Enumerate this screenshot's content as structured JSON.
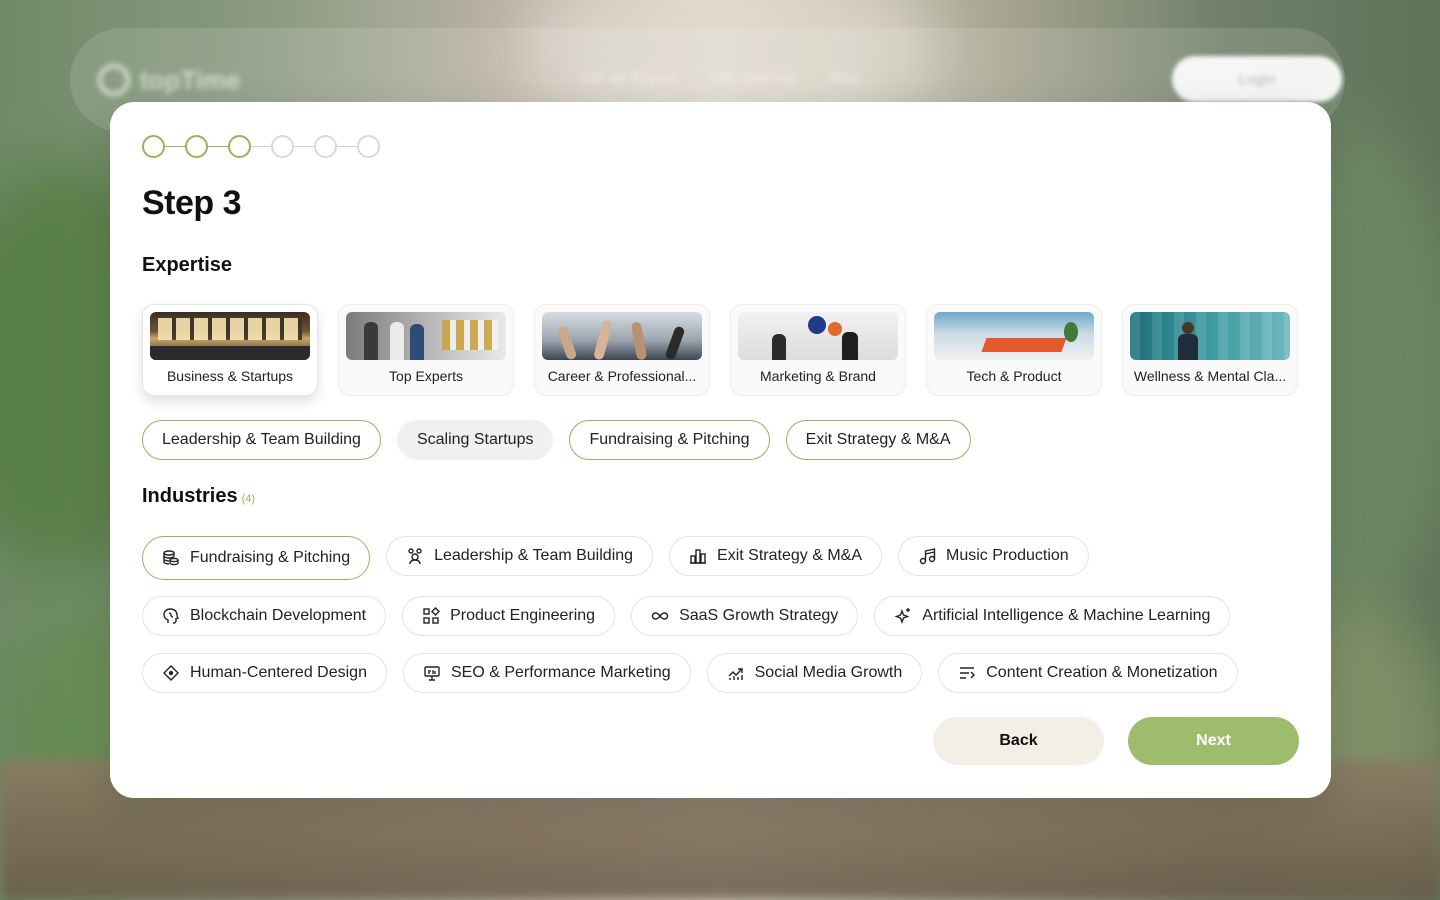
{
  "background": {
    "logo_text": "topTime",
    "menu": [
      "Get an Expert",
      "The Journey",
      "Blog"
    ],
    "login_label": "Login"
  },
  "stepper": {
    "total_steps": 6,
    "completed_steps": 3
  },
  "title": "Step 3",
  "expertise": {
    "label": "Expertise",
    "categories": [
      {
        "label": "Business & Startups",
        "selected": true,
        "icon": "office-photo"
      },
      {
        "label": "Top Experts",
        "selected": false,
        "icon": "team-photo"
      },
      {
        "label": "Career & Professional...",
        "selected": false,
        "icon": "hands-photo"
      },
      {
        "label": "Marketing & Brand",
        "selected": false,
        "icon": "marketing-photo"
      },
      {
        "label": "Tech & Product",
        "selected": false,
        "icon": "tech-photo"
      },
      {
        "label": "Wellness & Mental Cla...",
        "selected": false,
        "icon": "wellness-photo"
      }
    ],
    "tags": [
      {
        "label": "Leadership & Team Building",
        "style": "outline-green"
      },
      {
        "label": "Scaling Startups",
        "style": "filled-gray"
      },
      {
        "label": "Fundraising & Pitching",
        "style": "outline-green"
      },
      {
        "label": "Exit Strategy & M&A",
        "style": "outline-green"
      }
    ]
  },
  "industries": {
    "label": "Industries",
    "count": "(4)",
    "rows": [
      [
        {
          "label": "Fundraising & Pitching",
          "icon": "coins-icon",
          "selected": true
        },
        {
          "label": "Leadership & Team Building",
          "icon": "team-icon",
          "selected": false
        },
        {
          "label": "Exit Strategy & M&A",
          "icon": "chart-bars-icon",
          "selected": false
        },
        {
          "label": "Music Production",
          "icon": "music-note-icon",
          "selected": false
        }
      ],
      [
        {
          "label": "Blockchain Development",
          "icon": "brain-icon",
          "selected": false
        },
        {
          "label": "Product Engineering",
          "icon": "grid-icon",
          "selected": false
        },
        {
          "label": "SaaS Growth Strategy",
          "icon": "infinity-icon",
          "selected": false
        },
        {
          "label": "Artificial Intelligence & Machine Learning",
          "icon": "sparkle-icon",
          "selected": false
        }
      ],
      [
        {
          "label": "Human-Centered Design",
          "icon": "diamond-icon",
          "selected": false
        },
        {
          "label": "SEO & Performance Marketing",
          "icon": "monitor-icon",
          "selected": false
        },
        {
          "label": "Social Media Growth",
          "icon": "growth-chart-icon",
          "selected": false
        },
        {
          "label": "Content Creation & Monetization",
          "icon": "list-filter-icon",
          "selected": false
        }
      ]
    ]
  },
  "actions": {
    "back_label": "Back",
    "next_label": "Next"
  },
  "colors": {
    "accent": "#8fb85a",
    "next_button": "#9dbd6d",
    "back_button": "#f2efe6"
  }
}
